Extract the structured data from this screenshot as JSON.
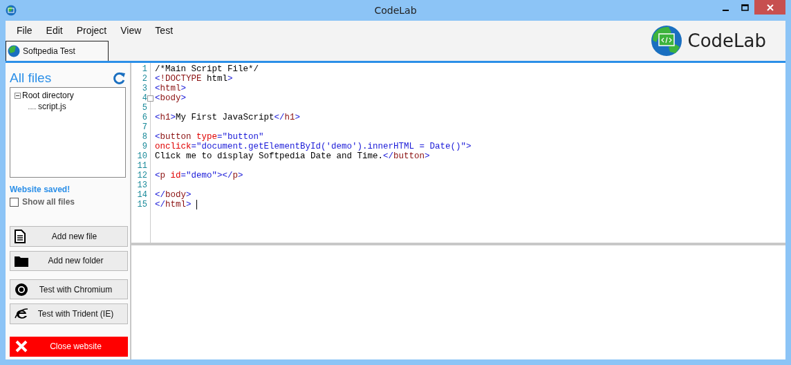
{
  "window": {
    "title": "CodeLab"
  },
  "menu": [
    "File",
    "Edit",
    "Project",
    "View",
    "Test"
  ],
  "logo": {
    "text": "CodeLab"
  },
  "tabs": [
    {
      "label": "Softpedia Test",
      "selected": true
    }
  ],
  "sidebar": {
    "heading": "All files",
    "tree": [
      {
        "label": "Root directory",
        "expanded": true,
        "children": [
          {
            "label": "script.js"
          }
        ]
      }
    ],
    "status": "Website saved!",
    "show_all": {
      "label": "Show all files",
      "checked": false
    },
    "buttons": [
      {
        "label": "Add new file",
        "kind": "file"
      },
      {
        "label": "Add new folder",
        "kind": "folder"
      },
      {
        "label": "Test with Chromium",
        "kind": "chromium"
      },
      {
        "label": "Test with Trident (IE)",
        "kind": "ie"
      },
      {
        "label": "Close website",
        "kind": "close"
      }
    ]
  },
  "editor": {
    "lines": [
      {
        "number": "1",
        "tokens": [
          {
            "text": "/*Main Script File*/",
            "kind": "text"
          }
        ]
      },
      {
        "number": "2",
        "tokens": [
          {
            "text": "<",
            "kind": "punct"
          },
          {
            "text": "!DOCTYPE",
            "kind": "name"
          },
          {
            "text": " html",
            "kind": "text"
          },
          {
            "text": ">",
            "kind": "punct"
          }
        ]
      },
      {
        "number": "3",
        "tokens": [
          {
            "text": "<",
            "kind": "punct"
          },
          {
            "text": "html",
            "kind": "name"
          },
          {
            "text": ">",
            "kind": "punct"
          }
        ]
      },
      {
        "number": "4",
        "fold": true,
        "tokens": [
          {
            "text": "<",
            "kind": "punct"
          },
          {
            "text": "body",
            "kind": "name"
          },
          {
            "text": ">",
            "kind": "punct"
          }
        ]
      },
      {
        "number": "5"
      },
      {
        "number": "6",
        "tokens": [
          {
            "text": "<",
            "kind": "punct"
          },
          {
            "text": "h1",
            "kind": "name"
          },
          {
            "text": ">",
            "kind": "punct"
          },
          {
            "text": "My First JavaScript",
            "kind": "text"
          },
          {
            "text": "</",
            "kind": "punct"
          },
          {
            "text": "h1",
            "kind": "name"
          },
          {
            "text": ">",
            "kind": "punct"
          }
        ]
      },
      {
        "number": "7"
      },
      {
        "number": "8",
        "tokens": [
          {
            "text": "<",
            "kind": "punct"
          },
          {
            "text": "button",
            "kind": "name"
          },
          {
            "text": " type",
            "kind": "attr"
          },
          {
            "text": "=",
            "kind": "punct"
          },
          {
            "text": "\"button\"",
            "kind": "value"
          }
        ]
      },
      {
        "number": "9",
        "tokens": [
          {
            "text": "onclick",
            "kind": "attr"
          },
          {
            "text": "=",
            "kind": "punct"
          },
          {
            "text": "\"document.getElementById('demo').innerHTML = Date()\"",
            "kind": "value"
          },
          {
            "text": ">",
            "kind": "punct"
          }
        ]
      },
      {
        "number": "10",
        "tokens": [
          {
            "text": "Click me to display Softpedia Date and Time.",
            "kind": "text"
          },
          {
            "text": "</",
            "kind": "punct"
          },
          {
            "text": "button",
            "kind": "name"
          },
          {
            "text": ">",
            "kind": "punct"
          }
        ]
      },
      {
        "number": "11"
      },
      {
        "number": "12",
        "tokens": [
          {
            "text": "<",
            "kind": "punct"
          },
          {
            "text": "p",
            "kind": "name"
          },
          {
            "text": " id",
            "kind": "attr"
          },
          {
            "text": "=",
            "kind": "punct"
          },
          {
            "text": "\"demo\"",
            "kind": "value"
          },
          {
            "text": "></",
            "kind": "punct"
          },
          {
            "text": "p",
            "kind": "name"
          },
          {
            "text": ">",
            "kind": "punct"
          }
        ]
      },
      {
        "number": "13"
      },
      {
        "number": "14",
        "tokens": [
          {
            "text": "</",
            "kind": "punct"
          },
          {
            "text": "body",
            "kind": "name"
          },
          {
            "text": ">",
            "kind": "punct"
          }
        ]
      },
      {
        "number": "15",
        "cursor": true,
        "tokens": [
          {
            "text": "</",
            "kind": "punct"
          },
          {
            "text": "html",
            "kind": "name"
          },
          {
            "text": ">",
            "kind": "punct"
          }
        ]
      }
    ]
  }
}
